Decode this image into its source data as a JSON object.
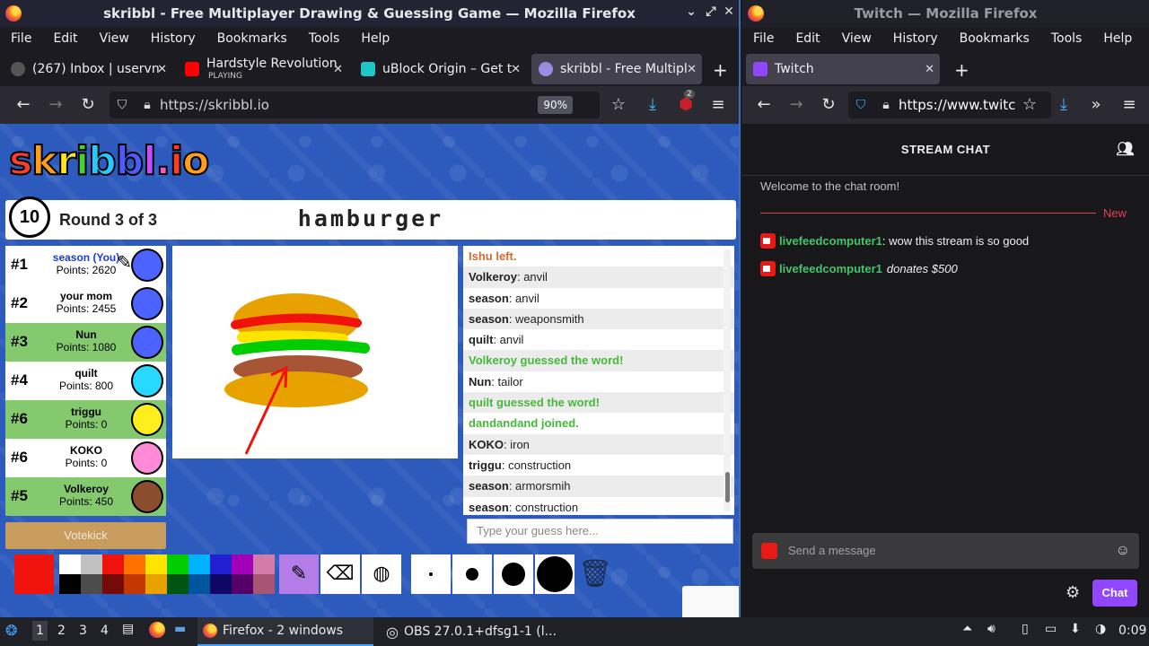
{
  "left_window": {
    "title": "skribbl - Free Multiplayer Drawing & Guessing Game — Mozilla Firefox",
    "menu": [
      "File",
      "Edit",
      "View",
      "History",
      "Bookmarks",
      "Tools",
      "Help"
    ],
    "tabs": [
      {
        "label": "(267) Inbox | uservn",
        "icon": "gmail-icon"
      },
      {
        "label": "Hardstyle Revolution",
        "sub": "PLAYING",
        "icon": "youtube-icon"
      },
      {
        "label": "uBlock Origin – Get t",
        "icon": "addon-icon"
      },
      {
        "label": "skribbl - Free Multipl",
        "icon": "skribbl-icon"
      }
    ],
    "url": "https://skribbl.io",
    "zoom": "90%",
    "badge": "2"
  },
  "game": {
    "logo_chars": [
      "s",
      "k",
      "r",
      "i",
      "b",
      "b",
      "l",
      ".",
      "i",
      "o"
    ],
    "timer": "10",
    "round": "Round 3 of 3",
    "word": "hamburger",
    "players": [
      {
        "rank": "#1",
        "name": "season (You)",
        "points": "Points: 2620",
        "avatar": "#4d63ff",
        "you": true,
        "drawing": true
      },
      {
        "rank": "#2",
        "name": "your mom",
        "points": "Points: 2455",
        "avatar": "#4d63ff"
      },
      {
        "rank": "#3",
        "name": "Nun",
        "points": "Points: 1080",
        "avatar": "#4d63ff",
        "guessed": true
      },
      {
        "rank": "#4",
        "name": "quilt",
        "points": "Points: 800",
        "avatar": "#27d8ff"
      },
      {
        "rank": "#6",
        "name": "triggu",
        "points": "Points: 0",
        "avatar": "#ffee1e",
        "guessed": true
      },
      {
        "rank": "#6",
        "name": "KOKO",
        "points": "Points: 0",
        "avatar": "#ff8ad8"
      },
      {
        "rank": "#5",
        "name": "Volkeroy",
        "points": "Points: 450",
        "avatar": "#8a4e2e",
        "guessed": true
      }
    ],
    "votekick": "Votekick",
    "chat": [
      {
        "type": "orange",
        "text": "Ishu left."
      },
      {
        "user": "Volkeroy",
        "text": "anvil"
      },
      {
        "user": "season",
        "text": "anvil"
      },
      {
        "user": "season",
        "text": "weaponsmith"
      },
      {
        "user": "quilt",
        "text": "anvil"
      },
      {
        "type": "green",
        "text": "Volkeroy guessed the word!"
      },
      {
        "user": "Nun",
        "text": "tailor"
      },
      {
        "type": "green",
        "text": "quilt guessed the word!"
      },
      {
        "type": "green",
        "text": "dandandand joined."
      },
      {
        "user": "KOKO",
        "text": "iron"
      },
      {
        "user": "triggu",
        "text": "construction"
      },
      {
        "user": "season",
        "text": "armorsmih"
      },
      {
        "user": "season",
        "text": "construction"
      }
    ],
    "guess_placeholder": "Type your guess here...",
    "current_color": "#ef130b",
    "palette": [
      "#ffffff",
      "#c1c1c1",
      "#ef130b",
      "#ff7100",
      "#ffe400",
      "#00cc00",
      "#00b2ff",
      "#231fd3",
      "#a300ba",
      "#d37caa",
      "#000000",
      "#4c4c4c",
      "#740b07",
      "#c23800",
      "#e8a200",
      "#005510",
      "#00569e",
      "#0e0865",
      "#550069",
      "#a75574"
    ],
    "extra_color": "#a0522d"
  },
  "right_window": {
    "title": "Twitch — Mozilla Firefox",
    "menu": [
      "File",
      "Edit",
      "View",
      "History",
      "Bookmarks",
      "Tools",
      "Help"
    ],
    "tab": "Twitch",
    "url": "https://www.twitc",
    "chat_header": "STREAM CHAT",
    "welcome": "Welcome to the chat room!",
    "new_label": "New",
    "messages": [
      {
        "user": "livefeedcomputer1",
        "text": ": wow this stream is so good"
      },
      {
        "user": "livefeedcomputer1",
        "text": "donates $500",
        "donation": true
      }
    ],
    "input_placeholder": "Send a message",
    "chat_button": "Chat"
  },
  "taskbar": {
    "desktops": [
      "1",
      "2",
      "3",
      "4"
    ],
    "apps": [
      {
        "label": "Firefox - 2 windows"
      },
      {
        "label": "OBS 27.0.1+dfsg1-1 (l..."
      }
    ],
    "clock": "0:09"
  }
}
